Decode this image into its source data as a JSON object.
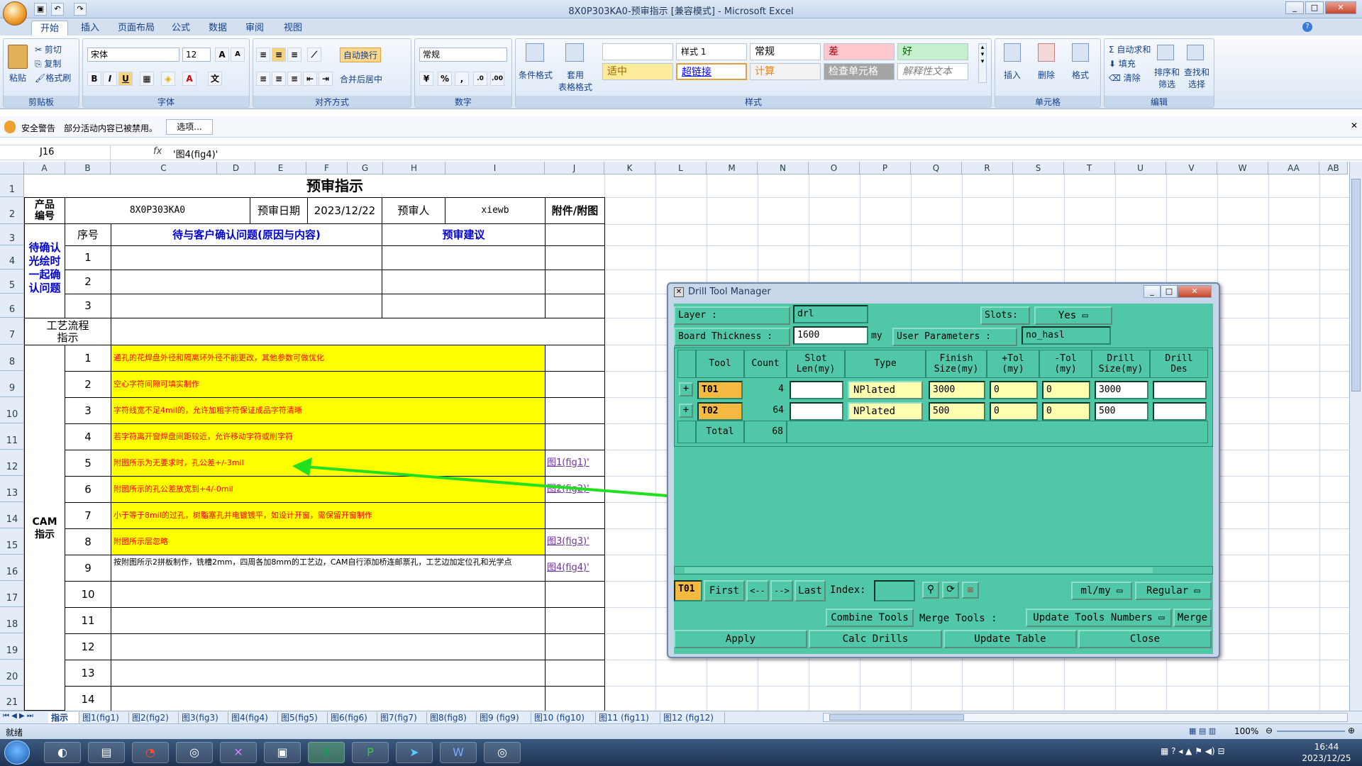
{
  "window": {
    "title": "8X0P303KA0-预审指示  [兼容模式] - Microsoft Excel"
  },
  "tabs": [
    "开始",
    "插入",
    "页面布局",
    "公式",
    "数据",
    "审阅",
    "视图"
  ],
  "ribbon": {
    "clipboard": {
      "paste": "粘贴",
      "cut": "剪切",
      "copy": "复制",
      "format_painter": "格式刷",
      "label": "剪贴板"
    },
    "font": {
      "name": "宋体",
      "size": "12",
      "label": "字体"
    },
    "alignment": {
      "wrap": "自动换行",
      "merge": "合并后居中",
      "label": "对齐方式"
    },
    "number": {
      "format": "常规",
      "label": "数字"
    },
    "styles": {
      "conditional": "条件格式",
      "table": "套用\n表格格式",
      "cells": [
        "",
        "样式 1",
        "常规",
        "差",
        "好",
        "适中",
        "超链接",
        "计算",
        "检查单元格",
        "解释性文本"
      ],
      "label": "样式"
    },
    "cells_group": {
      "insert": "插入",
      "delete": "删除",
      "format": "格式",
      "label": "单元格"
    },
    "editing": {
      "autosum": "自动求和",
      "fill": "填充",
      "clear": "清除",
      "sort": "排序和\n筛选",
      "find": "查找和\n选择",
      "label": "编辑"
    }
  },
  "security": {
    "label": "安全警告",
    "message": "部分活动内容已被禁用。",
    "options": "选项..."
  },
  "formula": {
    "cell_ref": "J16",
    "fx": "fx",
    "content": "'图4(fig4)'"
  },
  "columns": [
    "A",
    "B",
    "C",
    "D",
    "E",
    "F",
    "G",
    "H",
    "I",
    "J",
    "K",
    "L",
    "M",
    "N",
    "O",
    "P",
    "Q",
    "R",
    "S",
    "T",
    "U",
    "V",
    "W",
    "AA",
    "AB"
  ],
  "rows": [
    "1",
    "2",
    "3",
    "4",
    "5",
    "6",
    "7",
    "8",
    "9",
    "10",
    "11",
    "12",
    "13",
    "14",
    "15",
    "16",
    "17",
    "18",
    "19",
    "20",
    "21"
  ],
  "sheet": {
    "title": "预审指示",
    "product_label": "产品\n编号",
    "product_no": "8X0P303KA0",
    "date_label": "预审日期",
    "date": "2023/12/22",
    "reviewer_label": "预审人",
    "reviewer": "xiewb",
    "attach_label": "附件/附图",
    "seq_label": "序号",
    "issue_header": "待与客户确认问题(原因与内容)",
    "suggest_header": "预审建议",
    "side_confirm": "待确认\n光绘时\n一起确\n认问题",
    "flow_label": "工艺流程\n指示",
    "cam_label": "CAM\n指示",
    "confirm_rows": [
      "1",
      "2",
      "3"
    ],
    "cam_rows": [
      {
        "n": "1",
        "text": "通孔的花焊盘外径和隔离环外径不能更改，其他参数可做优化",
        "link": ""
      },
      {
        "n": "2",
        "text": "空心字符间隙可填实制作",
        "link": ""
      },
      {
        "n": "3",
        "text": "字符线宽不足4mil的，允许加粗字符保证成品字符清晰",
        "link": ""
      },
      {
        "n": "4",
        "text": "若字符离开窗焊盘间距较近，允许移动字符或削字符",
        "link": ""
      },
      {
        "n": "5",
        "text": "附图所示为无要求时，孔公差+/-3mil",
        "link": "图1(fig1)'"
      },
      {
        "n": "6",
        "text": "附图所示的孔公差放宽到+4/-0mil",
        "link": "图2(fig2)'"
      },
      {
        "n": "7",
        "text": "小于等于8mil的过孔，树脂塞孔并电镀镀平，如设计开窗，需保留开窗制作",
        "link": ""
      },
      {
        "n": "8",
        "text": "附图所示层忽略",
        "link": "图3(fig3)'"
      },
      {
        "n": "9",
        "text": "按附图所示2拼板制作，铣槽2mm，四周各加8mm的工艺边，CAM自行添加桥连邮票孔，工艺边加定位孔和光学点",
        "link": "图4(fig4)'"
      },
      {
        "n": "10",
        "text": "",
        "link": ""
      },
      {
        "n": "11",
        "text": "",
        "link": ""
      },
      {
        "n": "12",
        "text": "",
        "link": ""
      },
      {
        "n": "13",
        "text": "",
        "link": ""
      },
      {
        "n": "14",
        "text": "",
        "link": ""
      }
    ]
  },
  "sheet_tabs": [
    "指示",
    "图1(fig1)",
    "图2(fig2)",
    "图3(fig3)",
    "图4(fig4)",
    "图5(fig5)",
    "图6(fig6)",
    "图7(fig7)",
    "图8(fig8)",
    "图9 (fig9)",
    "图10 (fig10)",
    "图11 (fig11)",
    "图12 (fig12)"
  ],
  "status": {
    "ready": "就绪",
    "zoom": "100%"
  },
  "clock": {
    "time": "16:44",
    "date": "2023/12/25"
  },
  "dialog": {
    "title": "Drill Tool Manager",
    "layer_label": "Layer          :",
    "layer": "drl",
    "slots_label": "Slots:",
    "slots": "Yes",
    "thickness_label": "Board Thickness :",
    "thickness": "1600",
    "thickness_unit": "my",
    "userparam_label": "User Parameters :",
    "userparam": "no_hasl",
    "headers": [
      "Tool",
      "Count",
      "Slot\nLen(my)",
      "Type",
      "Finish\nSize(my)",
      "+Tol\n(my)",
      "-Tol\n(my)",
      "Drill\nSize(my)",
      "Drill\nDes"
    ],
    "tools": [
      {
        "tool": "T01",
        "count": "4",
        "slot": "",
        "type": "NPlated",
        "finish": "3000",
        "ptol": "0",
        "ntol": "0",
        "drill": "3000",
        "des": ""
      },
      {
        "tool": "T02",
        "count": "64",
        "slot": "",
        "type": "NPlated",
        "finish": "500",
        "ptol": "0",
        "ntol": "0",
        "drill": "500",
        "des": ""
      }
    ],
    "total_label": "Total",
    "total": "68",
    "nav": {
      "current": "T01",
      "first": "First",
      "prev": "<--",
      "next": "-->",
      "last": "Last",
      "index": "Index:",
      "units": "ml/my",
      "mode": "Regular"
    },
    "actions": {
      "combine": "Combine Tools",
      "merge_label": "Merge Tools :",
      "update_numbers": "Update Tools Numbers",
      "merge": "Merge",
      "apply": "Apply",
      "calc": "Calc Drills",
      "update_table": "Update Table",
      "close": "Close"
    }
  },
  "colors": {
    "accent": "#15428b",
    "yellow": "#ffff00",
    "dialog": "#50c8a8",
    "arrow": "#20e020"
  }
}
